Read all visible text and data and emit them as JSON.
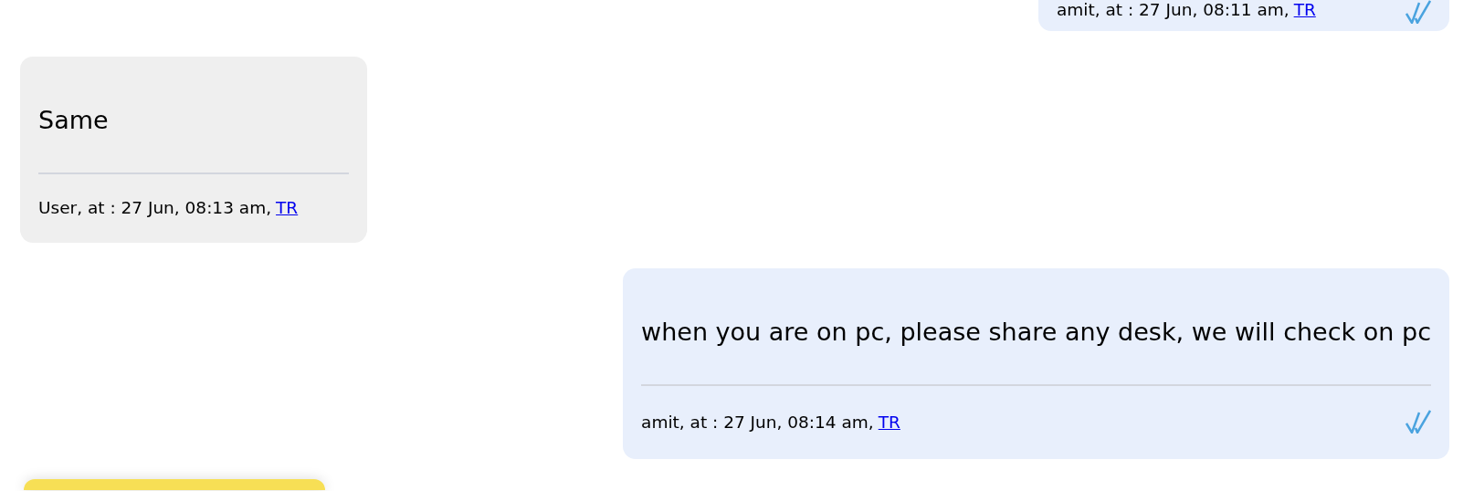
{
  "messages": [
    {
      "kind": "partial",
      "outgoing": true,
      "meta": "amit, at : 27 Jun, 08:11 am,",
      "link": "TR",
      "read": true
    },
    {
      "kind": "full",
      "outgoing": false,
      "text": "Same",
      "meta": "User, at : 27 Jun, 08:13 am,",
      "link": "TR"
    },
    {
      "kind": "full",
      "outgoing": true,
      "text": "when you are on pc, please share any desk, we will check on pc",
      "meta": "amit, at : 27 Jun, 08:14 am,",
      "link": "TR",
      "read": true
    },
    {
      "kind": "stub"
    }
  ]
}
